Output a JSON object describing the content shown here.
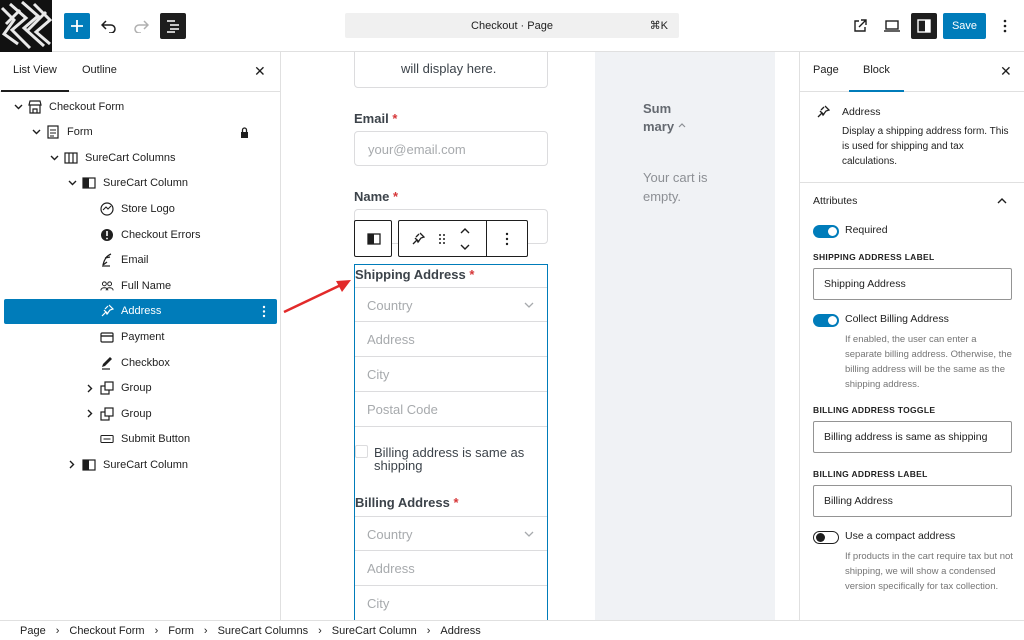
{
  "topbar": {
    "title": "Checkout · Page",
    "shortcut": "⌘K",
    "save_label": "Save"
  },
  "list_panel": {
    "tabs": [
      "List View",
      "Outline"
    ],
    "items": [
      {
        "label": "Checkout Form",
        "icon": "store-icon",
        "level": 0,
        "expanded": true
      },
      {
        "label": "Form",
        "icon": "form-icon",
        "level": 1,
        "expanded": true,
        "locked": true
      },
      {
        "label": "SureCart Columns",
        "icon": "columns-icon",
        "level": 2,
        "expanded": true
      },
      {
        "label": "SureCart Column",
        "icon": "column-icon",
        "level": 3,
        "expanded": true
      },
      {
        "label": "Store Logo",
        "icon": "logo-icon",
        "level": 4
      },
      {
        "label": "Checkout Errors",
        "icon": "alert-icon",
        "level": 4
      },
      {
        "label": "Email",
        "icon": "email-icon",
        "level": 4
      },
      {
        "label": "Full Name",
        "icon": "users-icon",
        "level": 4
      },
      {
        "label": "Address",
        "icon": "pin-icon",
        "level": 4,
        "selected": true
      },
      {
        "label": "Payment",
        "icon": "card-icon",
        "level": 4
      },
      {
        "label": "Checkbox",
        "icon": "pen-icon",
        "level": 4
      },
      {
        "label": "Group",
        "icon": "group-icon",
        "level": 4,
        "collapsed": true
      },
      {
        "label": "Group",
        "icon": "group-icon",
        "level": 4,
        "collapsed": true
      },
      {
        "label": "Submit Button",
        "icon": "button-icon",
        "level": 4
      },
      {
        "label": "SureCart Column",
        "icon": "column-icon",
        "level": 3,
        "collapsed": true
      }
    ]
  },
  "canvas": {
    "logo_text": "will display here.",
    "email_label": "Email",
    "email_placeholder": "your@email.com",
    "name_label": "Name",
    "shipping_label": "Shipping Address",
    "shipping_fields": [
      "Country",
      "Address",
      "City",
      "Postal Code"
    ],
    "same_as_shipping": "Billing address is same as shipping",
    "billing_label": "Billing Address",
    "billing_fields": [
      "Country",
      "Address",
      "City"
    ],
    "summary_title": "Summary",
    "summary_empty": "Your cart is empty."
  },
  "settings": {
    "tabs": [
      "Page",
      "Block"
    ],
    "block_name": "Address",
    "block_desc": "Display a shipping address form. This is used for shipping and tax calculations.",
    "attributes_title": "Attributes",
    "required_label": "Required",
    "shipping_label_title": "SHIPPING ADDRESS LABEL",
    "shipping_label_value": "Shipping Address",
    "collect_billing_label": "Collect Billing Address",
    "collect_billing_help": "If enabled, the user can enter a separate billing address. Otherwise, the billing address will be the same as the shipping address.",
    "billing_toggle_title": "BILLING ADDRESS TOGGLE",
    "billing_toggle_value": "Billing address is same as shipping",
    "billing_label_title": "BILLING ADDRESS LABEL",
    "billing_label_value": "Billing Address",
    "compact_label": "Use a compact address",
    "compact_help": "If products in the cart require tax but not shipping, we will show a condensed version specifically for tax collection."
  },
  "breadcrumb": [
    "Page",
    "Checkout Form",
    "Form",
    "SureCart Columns",
    "SureCart Column",
    "Address"
  ],
  "colors": {
    "accent": "#007cba",
    "required": "#d63638",
    "arrow": "#e22a2a"
  }
}
